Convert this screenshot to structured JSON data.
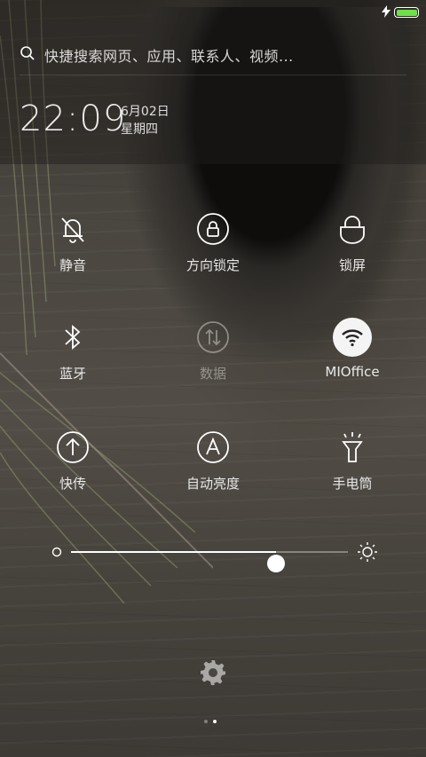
{
  "status_bar": {
    "charging_icon": "lightning-icon",
    "battery_icon": "battery-full-icon",
    "battery_level": 1.0,
    "battery_color": "#6ee04a"
  },
  "search": {
    "placeholder": "快捷搜索网页、应用、联系人、视频..."
  },
  "clock": {
    "time": "22:09",
    "date": "6月02日",
    "weekday": "星期四"
  },
  "tiles": [
    {
      "label": "静音",
      "icon": "bell-off-icon",
      "active": false
    },
    {
      "label": "方向锁定",
      "icon": "rotation-lock-icon",
      "active": false
    },
    {
      "label": "锁屏",
      "icon": "lock-icon",
      "active": false
    },
    {
      "label": "蓝牙",
      "icon": "bluetooth-icon",
      "active": false
    },
    {
      "label": "数据",
      "icon": "mobile-data-icon",
      "active": false,
      "disabled": true
    },
    {
      "label": "MIOffice",
      "icon": "wifi-icon",
      "active": true
    },
    {
      "label": "快传",
      "icon": "upload-icon",
      "active": false
    },
    {
      "label": "自动亮度",
      "icon": "auto-brightness-icon",
      "active": false
    },
    {
      "label": "手电筒",
      "icon": "flashlight-icon",
      "active": false
    }
  ],
  "brightness": {
    "level": 0.74,
    "low_icon": "brightness-low-icon",
    "high_icon": "brightness-high-icon"
  },
  "footer": {
    "settings_icon": "gear-icon",
    "page_count": 2,
    "current_page": 2
  }
}
